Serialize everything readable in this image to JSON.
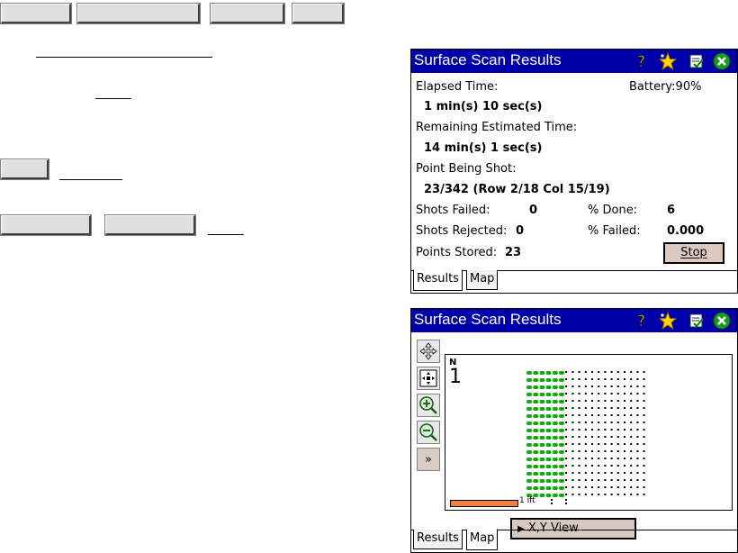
{
  "window1": {
    "title": "Surface Scan Results",
    "elapsed_label": "Elapsed Time:",
    "elapsed_value": "1 min(s) 10 sec(s)",
    "battery": "Battery:90%",
    "remaining_label": "Remaining Estimated Time:",
    "remaining_value": "14 min(s) 1 sec(s)",
    "point_label": "Point Being Shot:",
    "point_value": "23/342 (Row 2/18  Col 15/19)",
    "shots_failed_label": "Shots Failed:",
    "shots_failed_value": "0",
    "pct_done_label": "% Done:",
    "pct_done_value": "6",
    "shots_rejected_label": "Shots Rejected:",
    "shots_rejected_value": "0",
    "pct_failed_label": "% Failed:",
    "pct_failed_value": "0.000",
    "points_stored_label": "Points Stored:",
    "points_stored_value": "23",
    "stop_label": "Stop",
    "tabs": [
      "Results",
      "Map"
    ],
    "active_tab": "Results"
  },
  "window2": {
    "title": "Surface Scan Results",
    "north_letter": "N",
    "north_number": "1",
    "scale_label": "1 ift",
    "expand_label": "»",
    "xy_view_label": "X,Y View",
    "tabs": [
      "Results",
      "Map"
    ],
    "active_tab": "Map",
    "grid": {
      "rows": 18,
      "cols": 19,
      "shot_cols": 6
    }
  },
  "icons": {
    "help": "help-question-icon",
    "favorite": "favorite-star-icon",
    "checklist": "checklist-icon",
    "close": "close-icon"
  },
  "colors": {
    "titlebar": "#0000a8",
    "shot_point": "#11aa11",
    "scale_bar": "#f08040"
  }
}
